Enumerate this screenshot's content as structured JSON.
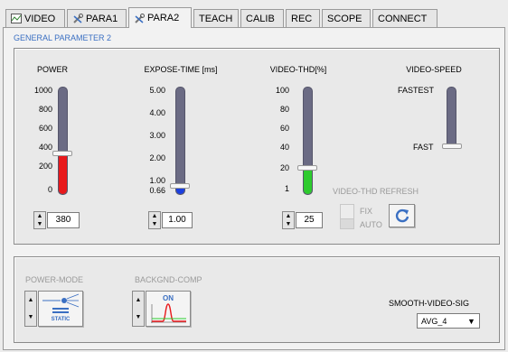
{
  "tabs": [
    {
      "label": "VIDEO",
      "icon": "video-icon"
    },
    {
      "label": "PARA1",
      "icon": "tools-icon"
    },
    {
      "label": "PARA2",
      "icon": "tools-icon"
    },
    {
      "label": "TEACH"
    },
    {
      "label": "CALIB"
    },
    {
      "label": "REC"
    },
    {
      "label": "SCOPE"
    },
    {
      "label": "CONNECT"
    }
  ],
  "active_tab": "PARA2",
  "section_title": "GENERAL PARAMETER 2",
  "power": {
    "label": "POWER",
    "ticks": [
      "1000",
      "800",
      "600",
      "400",
      "200",
      "0"
    ],
    "value": "380",
    "level": 0.38,
    "color": "#e8191c"
  },
  "expose": {
    "label": "EXPOSE-TIME [ms]",
    "ticks": [
      "5.00",
      "4.00",
      "3.00",
      "2.00",
      "1.00",
      "0.66"
    ],
    "value": "1.00",
    "level": 0.08,
    "color": "#1a3fe0"
  },
  "video_thd": {
    "label": "VIDEO-THD[%]",
    "ticks": [
      "100",
      "80",
      "60",
      "40",
      "20",
      "1"
    ],
    "value": "25",
    "level": 0.25,
    "color": "#2ecb2e"
  },
  "video_speed": {
    "label": "VIDEO-SPEED",
    "top": "FASTEST",
    "bottom": "FAST"
  },
  "thd_refresh": {
    "label": "VIDEO-THD REFRESH",
    "fix": "FIX",
    "auto": "AUTO"
  },
  "power_mode": {
    "label": "POWER-MODE",
    "icon_text": "STATIC"
  },
  "backgnd_comp": {
    "label": "BACKGND-COMP",
    "icon_text": "ON"
  },
  "smooth": {
    "label": "SMOOTH-VIDEO-SIG",
    "value": "AVG_4"
  },
  "colors": {
    "accent": "#3a6fc2",
    "track": "#6b6b84"
  }
}
